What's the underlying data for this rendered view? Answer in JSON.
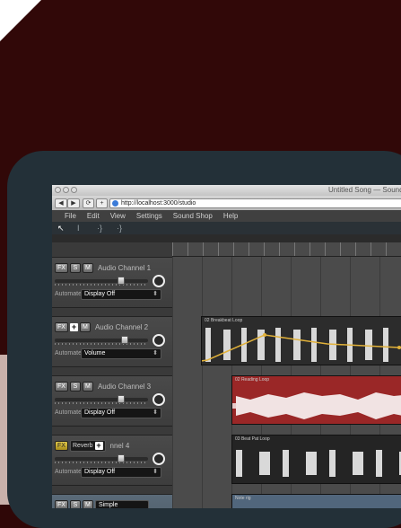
{
  "window": {
    "title": "Untitled Song — Sounda"
  },
  "browser": {
    "url": "http://localhost:3000/studio",
    "back": "◀",
    "forward": "▶",
    "reload": "⟳",
    "add": "+"
  },
  "menu": [
    "File",
    "Edit",
    "View",
    "Settings",
    "Sound Shop",
    "Help"
  ],
  "tools": {
    "pointer": "↖",
    "cursor": "I",
    "tool3": "·}",
    "tool4": "·}"
  },
  "channels": [
    {
      "name": "Audio Channel 1",
      "fx": "FX",
      "s": "S",
      "m": "M",
      "automate_label": "Automate:",
      "automate": "Display Off"
    },
    {
      "name": "Audio Channel 2",
      "fx": "FX",
      "s": "+",
      "m": "M",
      "automate_label": "Automate:",
      "automate": "Volume"
    },
    {
      "name": "Audio Channel 3",
      "fx": "FX",
      "s": "S",
      "m": "M",
      "automate_label": "Automate:",
      "automate": "Display Off"
    },
    {
      "name": "nnel 4",
      "fx": "FX",
      "fx_effect": "Reverb",
      "automate_label": "Automate:",
      "automate": "Display Off"
    },
    {
      "name": "Simple",
      "fx": "FX",
      "s": "S",
      "m": "M"
    }
  ],
  "clips": [
    {
      "label": "02 Breakbeat Loop",
      "color": "#2c2c2c"
    },
    {
      "label": "02 Reading Loop",
      "color": "#9a2727"
    },
    {
      "label": "03 Beat Pat Loop",
      "color": "#242424"
    },
    {
      "label": "Note rig",
      "color": "#51667c"
    }
  ],
  "colors": {
    "accent": "#e2c94a",
    "automation": "#e2b23a",
    "selected_panel": "#5a6a78"
  }
}
